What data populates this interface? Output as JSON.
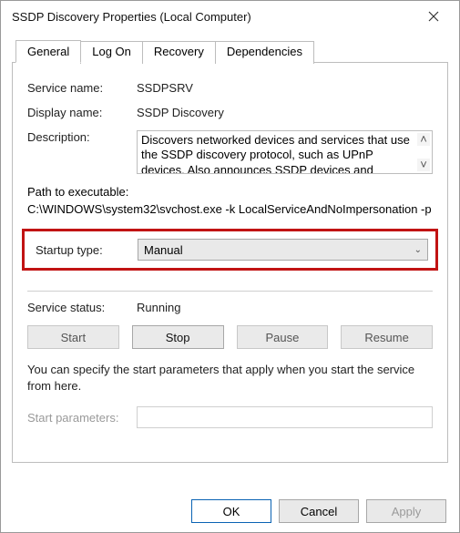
{
  "window": {
    "title": "SSDP Discovery Properties (Local Computer)"
  },
  "tabs": [
    "General",
    "Log On",
    "Recovery",
    "Dependencies"
  ],
  "fields": {
    "service_name_label": "Service name:",
    "service_name": "SSDPSRV",
    "display_name_label": "Display name:",
    "display_name": "SSDP Discovery",
    "description_label": "Description:",
    "description": "Discovers networked devices and services that use the SSDP discovery protocol, such as UPnP devices. Also announces SSDP devices and services running",
    "path_label": "Path to executable:",
    "path": "C:\\WINDOWS\\system32\\svchost.exe -k LocalServiceAndNoImpersonation -p",
    "startup_type_label": "Startup type:",
    "startup_type": "Manual",
    "service_status_label": "Service status:",
    "service_status": "Running"
  },
  "service_buttons": {
    "start": "Start",
    "stop": "Stop",
    "pause": "Pause",
    "resume": "Resume"
  },
  "hint": "You can specify the start parameters that apply when you start the service from here.",
  "start_params_label": "Start parameters:",
  "start_params_value": "",
  "dialog_buttons": {
    "ok": "OK",
    "cancel": "Cancel",
    "apply": "Apply"
  }
}
